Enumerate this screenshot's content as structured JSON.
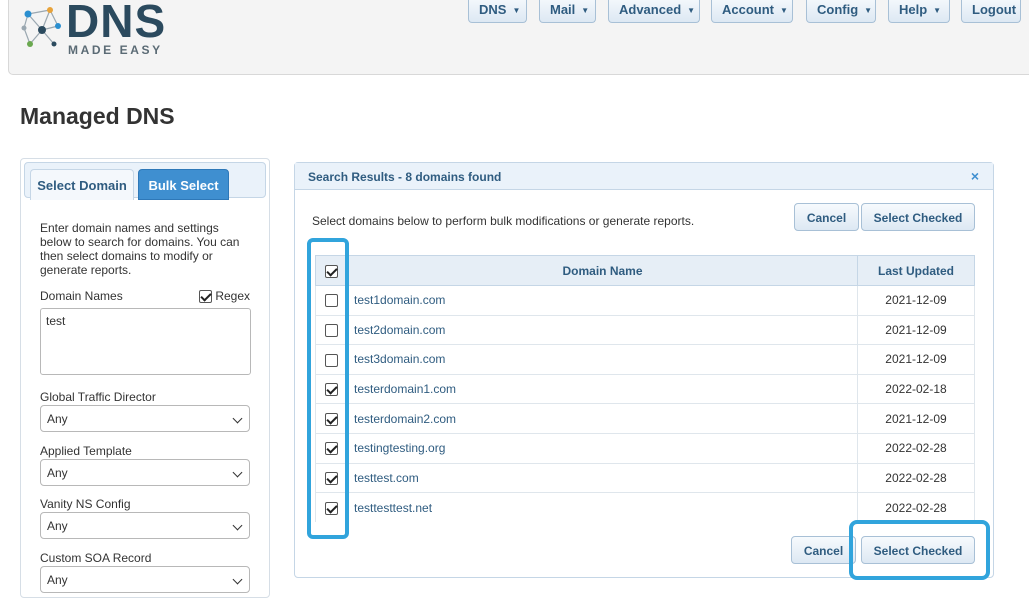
{
  "logo": {
    "main": "DNS",
    "sub": "MADE EASY"
  },
  "nav": [
    {
      "label": "DNS",
      "dropdown": true
    },
    {
      "label": "Mail",
      "dropdown": true
    },
    {
      "label": "Advanced",
      "dropdown": true
    },
    {
      "label": "Account",
      "dropdown": true
    },
    {
      "label": "Config",
      "dropdown": true
    },
    {
      "label": "Help",
      "dropdown": true
    },
    {
      "label": "Logout",
      "dropdown": false
    }
  ],
  "page_title": "Managed DNS",
  "left_panel": {
    "tabs": [
      {
        "label": "Select Domain",
        "active": false
      },
      {
        "label": "Bulk Select",
        "active": true
      }
    ],
    "description": "Enter domain names and settings below to search for domains. You can then select domains to modify or generate reports.",
    "domain_names_label": "Domain Names",
    "regex_label": "Regex",
    "regex_checked": true,
    "domain_names_value": "test",
    "fields": [
      {
        "label": "Global Traffic Director",
        "value": "Any"
      },
      {
        "label": "Applied Template",
        "value": "Any"
      },
      {
        "label": "Vanity NS Config",
        "value": "Any"
      },
      {
        "label": "Custom SOA Record",
        "value": "Any"
      }
    ]
  },
  "results": {
    "header": "Search Results - 8 domains found",
    "close_icon": "×",
    "description": "Select domains below to perform bulk modifications or generate reports.",
    "cancel_label": "Cancel",
    "select_checked_label": "Select Checked",
    "columns": {
      "name": "Domain Name",
      "updated": "Last Updated"
    },
    "all_checked": true,
    "rows": [
      {
        "name": "test1domain.com",
        "updated": "2021-12-09",
        "checked": false
      },
      {
        "name": "test2domain.com",
        "updated": "2021-12-09",
        "checked": false
      },
      {
        "name": "test3domain.com",
        "updated": "2021-12-09",
        "checked": false
      },
      {
        "name": "testerdomain1.com",
        "updated": "2022-02-18",
        "checked": true
      },
      {
        "name": "testerdomain2.com",
        "updated": "2021-12-09",
        "checked": true
      },
      {
        "name": "testingtesting.org",
        "updated": "2022-02-28",
        "checked": true
      },
      {
        "name": "testtest.com",
        "updated": "2022-02-28",
        "checked": true
      },
      {
        "name": "testtesttest.net",
        "updated": "2022-02-28",
        "checked": true
      }
    ]
  },
  "colors": {
    "accent": "#3f8fd0",
    "highlight": "#31a4dc",
    "link": "#2f5c80"
  }
}
